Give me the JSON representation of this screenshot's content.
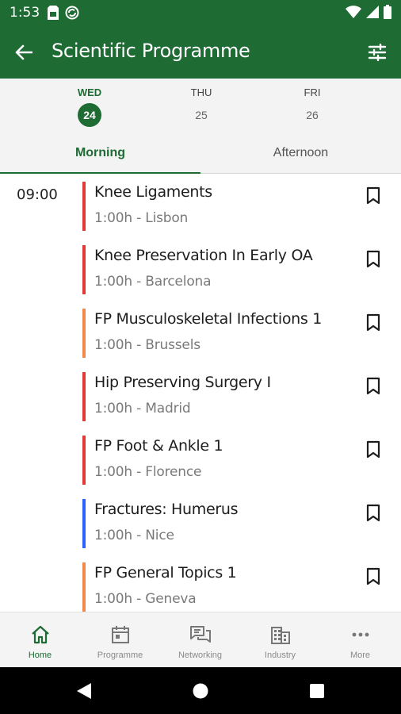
{
  "status": {
    "time": "1:53"
  },
  "header": {
    "title": "Scientific Programme"
  },
  "days": [
    {
      "name": "WED",
      "num": "24",
      "active": true
    },
    {
      "name": "THU",
      "num": "25",
      "active": false
    },
    {
      "name": "FRI",
      "num": "26",
      "active": false
    }
  ],
  "tabs": [
    {
      "label": "Morning",
      "active": true
    },
    {
      "label": "Afternoon",
      "active": false
    }
  ],
  "schedule": {
    "time": "09:00",
    "sessions": [
      {
        "title": "Knee Ligaments",
        "meta": "1:00h - Lisbon",
        "color": "#e53935"
      },
      {
        "title": "Knee Preservation In Early OA",
        "meta": "1:00h - Barcelona",
        "color": "#e53935"
      },
      {
        "title": "FP Musculoskeletal Infections 1",
        "meta": "1:00h - Brussels",
        "color": "#f0894a"
      },
      {
        "title": "Hip Preserving Surgery I",
        "meta": "1:00h - Madrid",
        "color": "#e53935"
      },
      {
        "title": "FP Foot & Ankle 1",
        "meta": "1:00h - Florence",
        "color": "#e53935"
      },
      {
        "title": "Fractures: Humerus",
        "meta": "1:00h - Nice",
        "color": "#2962ff"
      },
      {
        "title": "FP General Topics 1",
        "meta": "1:00h - Geneva",
        "color": "#f0894a"
      }
    ]
  },
  "bottom_nav": [
    {
      "label": "Home",
      "icon": "home-icon",
      "active": true
    },
    {
      "label": "Programme",
      "icon": "calendar-icon",
      "active": false
    },
    {
      "label": "Networking",
      "icon": "chat-icon",
      "active": false
    },
    {
      "label": "Industry",
      "icon": "building-icon",
      "active": false
    },
    {
      "label": "More",
      "icon": "more-icon",
      "active": false
    }
  ],
  "colors": {
    "primary": "#1e6b34",
    "surface": "#f3f3f3",
    "red": "#e53935",
    "orange": "#f0894a",
    "blue": "#2962ff"
  }
}
